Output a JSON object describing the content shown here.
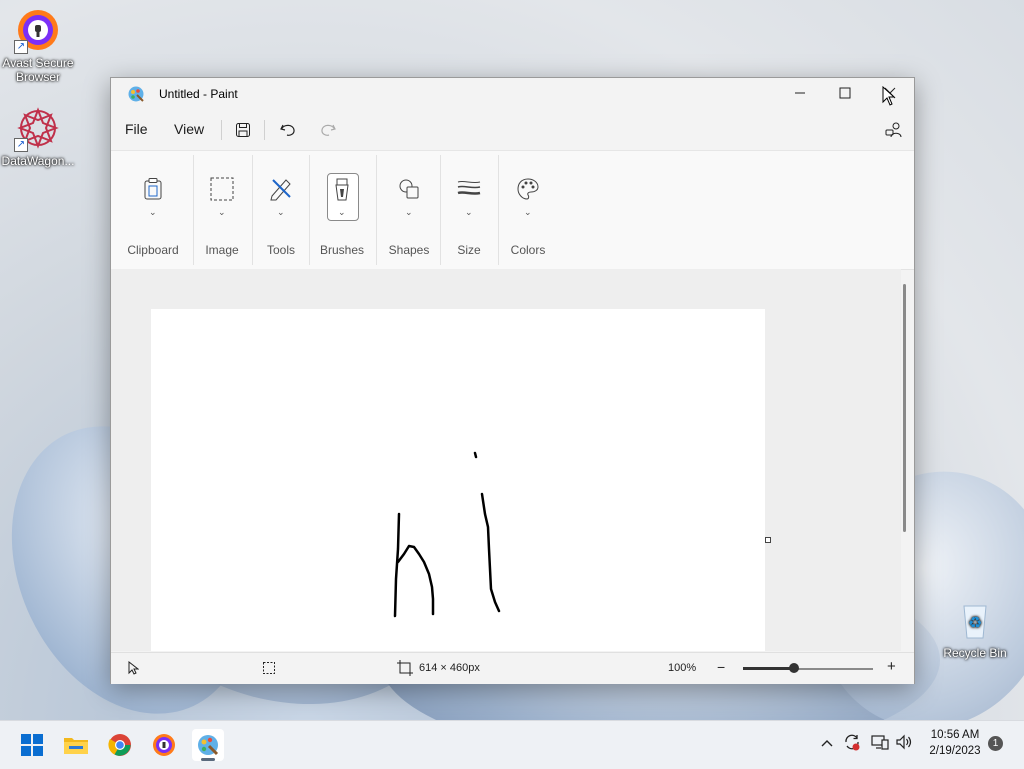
{
  "desktop": {
    "icons": [
      {
        "label": "Avast Secure Browser"
      },
      {
        "label": "DataWagon..."
      },
      {
        "label": "Recycle Bin"
      }
    ]
  },
  "window": {
    "title": "Untitled - Paint",
    "controls": {
      "minimize": "–",
      "maximize": "☐",
      "close": "✕"
    }
  },
  "menubar": {
    "file": "File",
    "view": "View"
  },
  "ribbon": {
    "groups": [
      {
        "label": "Clipboard"
      },
      {
        "label": "Image"
      },
      {
        "label": "Tools"
      },
      {
        "label": "Brushes"
      },
      {
        "label": "Shapes"
      },
      {
        "label": "Size"
      },
      {
        "label": "Colors"
      }
    ]
  },
  "canvas": {
    "drawing_text": "hi"
  },
  "statusbar": {
    "dimensions": "614 × 460px",
    "zoom": "100%",
    "zoom_minus": "−",
    "zoom_plus": "+"
  },
  "taskbar": {
    "time": "10:56 AM",
    "date": "2/19/2023",
    "notification_count": "1"
  },
  "colors": {
    "accent": "#0067c0"
  }
}
